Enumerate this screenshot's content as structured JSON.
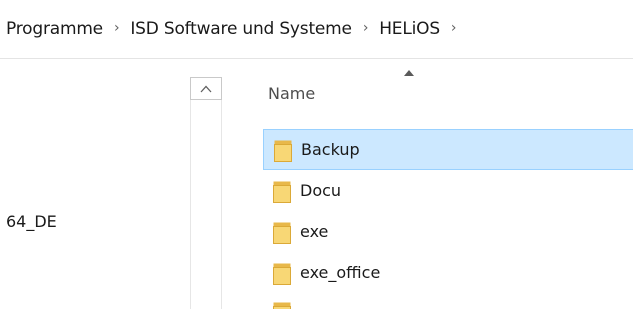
{
  "breadcrumb": {
    "items": [
      {
        "label": "Programme"
      },
      {
        "label": "ISD Software und Systeme"
      },
      {
        "label": "HELiOS"
      }
    ],
    "separator": "›"
  },
  "nav_pane": {
    "visible_item": "64_DE"
  },
  "file_list": {
    "columns": {
      "name": "Name"
    },
    "sort": "ascending",
    "rows": [
      {
        "label": "Backup",
        "selected": true,
        "icon": "folder-icon"
      },
      {
        "label": "Docu",
        "selected": false,
        "icon": "folder-icon"
      },
      {
        "label": "exe",
        "selected": false,
        "icon": "folder-icon"
      },
      {
        "label": "exe_office",
        "selected": false,
        "icon": "folder-icon"
      }
    ]
  },
  "colors": {
    "selection_fill": "#cce8ff",
    "selection_border": "#99d1ff",
    "folder_body": "#f8d775",
    "folder_tab": "#e8b84a"
  }
}
